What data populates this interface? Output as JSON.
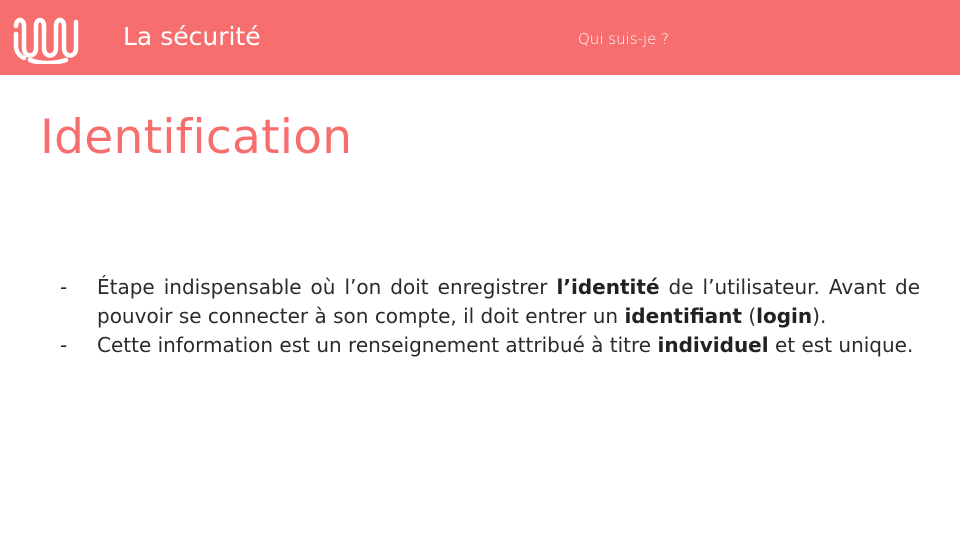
{
  "header": {
    "title": "La sécurité",
    "subtitle": "Qui suis-je ?",
    "color": "#f76e6e"
  },
  "slide": {
    "title": "Identification",
    "bullets": [
      {
        "marker": "-",
        "parts": [
          "Étape indispensable où l’on doit enregistrer ",
          "l’identité",
          " de l’utilisateur. Avant de pouvoir se connecter à son compte, il doit entrer un ",
          "identifiant",
          " (",
          "login",
          ")."
        ]
      },
      {
        "marker": "-",
        "parts": [
          "Cette information est un renseignement attribué à titre ",
          "individuel",
          " et est unique."
        ]
      }
    ]
  },
  "icons": {
    "logo": "wavy-line-logo-icon"
  }
}
